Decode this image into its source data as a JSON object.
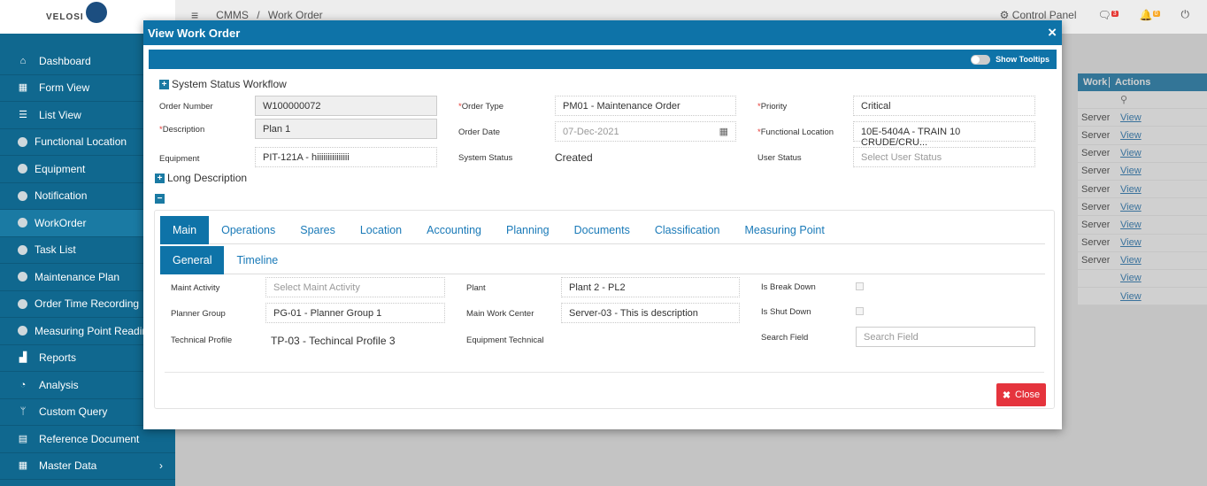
{
  "logo": {
    "text": "VELOSI"
  },
  "sidebar": {
    "items": [
      {
        "label": "Dashboard",
        "icon": "home-icon"
      },
      {
        "label": "Form View",
        "icon": "table-icon"
      },
      {
        "label": "List View",
        "icon": "list-icon"
      },
      {
        "label": "Functional Location",
        "icon": "circle-icon"
      },
      {
        "label": "Equipment",
        "icon": "circle-icon"
      },
      {
        "label": "Notification",
        "icon": "circle-icon"
      },
      {
        "label": "WorkOrder",
        "icon": "circle-icon"
      },
      {
        "label": "Task List",
        "icon": "circle-icon"
      },
      {
        "label": "Maintenance Plan",
        "icon": "circle-icon"
      },
      {
        "label": "Order Time Recording",
        "icon": "circle-icon"
      },
      {
        "label": "Measuring Point Reading",
        "icon": "circle-icon"
      },
      {
        "label": "Reports",
        "icon": "chart-icon"
      },
      {
        "label": "Analysis",
        "icon": "pie-icon"
      },
      {
        "label": "Custom Query",
        "icon": "branch-icon"
      },
      {
        "label": "Reference Document",
        "icon": "file-icon"
      },
      {
        "label": "Master Data",
        "icon": "table-icon"
      }
    ]
  },
  "topbar": {
    "breadcrumb_root": "CMMS",
    "breadcrumb_sep": "/",
    "breadcrumb_page": "Work Order",
    "control_panel": "Control Panel",
    "msg_count": "3",
    "notif_count": "0"
  },
  "bg_table": {
    "headers": [
      "Work",
      "Actions"
    ],
    "rows": [
      {
        "c1": "Server",
        "c2": "View"
      },
      {
        "c1": "Server",
        "c2": "View"
      },
      {
        "c1": "Server",
        "c2": "View"
      },
      {
        "c1": "Server",
        "c2": "View"
      },
      {
        "c1": "Server",
        "c2": "View"
      },
      {
        "c1": "Server",
        "c2": "View"
      },
      {
        "c1": "Server",
        "c2": "View"
      },
      {
        "c1": "Server",
        "c2": "View"
      },
      {
        "c1": "Server",
        "c2": "View"
      },
      {
        "c1": "",
        "c2": "View"
      },
      {
        "c1": "",
        "c2": "View"
      }
    ]
  },
  "modal": {
    "title": "View Work Order",
    "close_x": "×",
    "show_tooltips": "Show Tooltips",
    "system_status_workflow": "System Status Workflow",
    "long_description": "Long Description",
    "header_fields": {
      "order_number_label": "Order Number",
      "order_number": "W100000072",
      "description_label": "Description",
      "description": "Plan 1",
      "equipment_label": "Equipment",
      "equipment": "PIT-121A - hiiiiiiiiiiiiiii",
      "order_type_label": "Order Type",
      "order_type": "PM01 - Maintenance Order",
      "order_date_label": "Order Date",
      "order_date": "07-Dec-2021",
      "system_status_label": "System Status",
      "system_status": "Created",
      "priority_label": "Priority",
      "priority": "Critical",
      "functional_location_label": "Functional Location",
      "functional_location": "10E-5404A - TRAIN 10 CRUDE/CRU...",
      "user_status_label": "User Status",
      "user_status_placeholder": "Select User Status"
    },
    "tabs": [
      "Main",
      "Operations",
      "Spares",
      "Location",
      "Accounting",
      "Planning",
      "Documents",
      "Classification",
      "Measuring Point"
    ],
    "subtabs": [
      "General",
      "Timeline"
    ],
    "general": {
      "maint_activity_label": "Maint Activity",
      "maint_activity_placeholder": "Select Maint Activity",
      "planner_group_label": "Planner Group",
      "planner_group": "PG-01 - Planner Group 1",
      "technical_profile_label": "Technical Profile",
      "technical_profile": "TP-03 - Techincal Profile 3",
      "plant_label": "Plant",
      "plant": "Plant 2 - PL2",
      "main_work_center_label": "Main Work Center",
      "main_work_center": "Server-03 - This is description",
      "equipment_technical_label": "Equipment Technical",
      "is_break_down_label": "Is Break Down",
      "is_shut_down_label": "Is Shut Down",
      "search_field_label": "Search Field",
      "search_field_placeholder": "Search Field"
    },
    "close_button": "Close"
  }
}
